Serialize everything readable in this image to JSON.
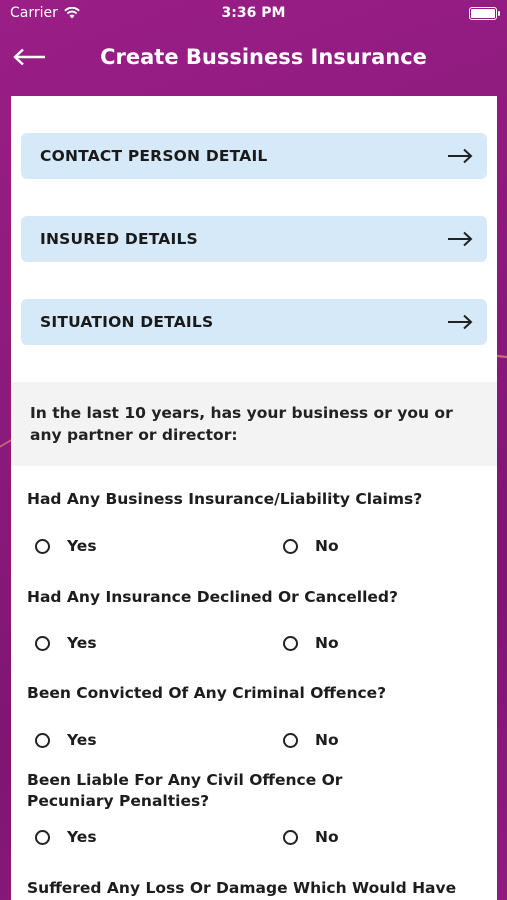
{
  "status_bar": {
    "carrier": "Carrier",
    "time": "3:36 PM"
  },
  "header": {
    "title": "Create Bussiness Insurance"
  },
  "sections": [
    {
      "label": "CONTACT PERSON DETAIL"
    },
    {
      "label": "INSURED DETAILS"
    },
    {
      "label": "SITUATION DETAILS"
    }
  ],
  "intro": "In the last 10 years, has your business or you or any partner or director:",
  "questions": [
    {
      "text": "Had Any Business Insurance/Liability Claims?",
      "yes": "Yes",
      "no": "No"
    },
    {
      "text": "Had Any Insurance Declined Or Cancelled?",
      "yes": "Yes",
      "no": "No"
    },
    {
      "text": "Been Convicted Of Any Criminal Offence?",
      "yes": "Yes",
      "no": "No"
    },
    {
      "text": "Been Liable For Any Civil Offence Or Pecuniary Penalties?",
      "yes": "Yes",
      "no": "No"
    },
    {
      "text": "Suffered Any Loss Or Damage Which Would Have"
    }
  ]
}
